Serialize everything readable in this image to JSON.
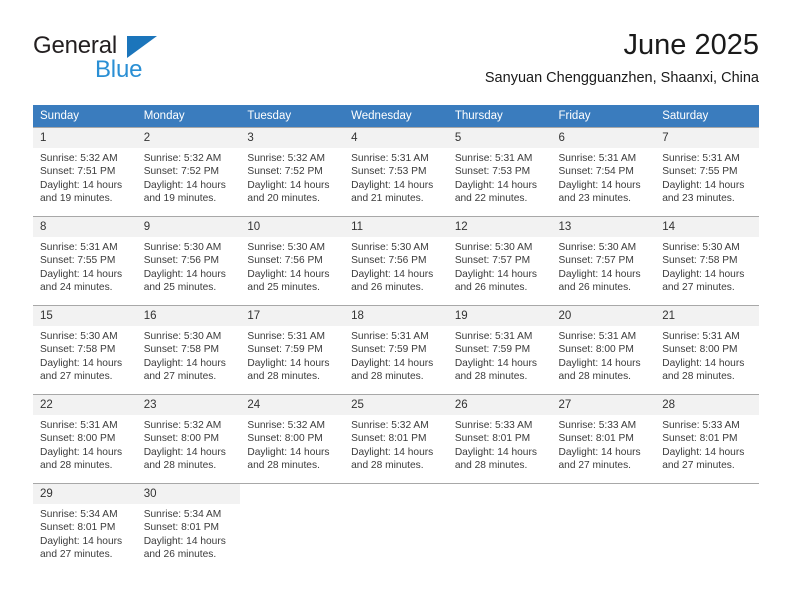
{
  "brand": {
    "name_top": "General",
    "name_bottom": "Blue",
    "accent_color": "#1b75bb",
    "accent_color_light": "#2a8fd4"
  },
  "header": {
    "title": "June 2025",
    "subtitle": "Sanyuan Chengguanzhen, Shaanxi, China"
  },
  "calendar": {
    "header_bg": "#3a7cbe",
    "daynum_bg": "#f2f2f2",
    "weekday_headers": [
      "Sunday",
      "Monday",
      "Tuesday",
      "Wednesday",
      "Thursday",
      "Friday",
      "Saturday"
    ],
    "weeks": [
      [
        {
          "day": "1",
          "sunrise": "Sunrise: 5:32 AM",
          "sunset": "Sunset: 7:51 PM",
          "daylight_1": "Daylight: 14 hours",
          "daylight_2": "and 19 minutes."
        },
        {
          "day": "2",
          "sunrise": "Sunrise: 5:32 AM",
          "sunset": "Sunset: 7:52 PM",
          "daylight_1": "Daylight: 14 hours",
          "daylight_2": "and 19 minutes."
        },
        {
          "day": "3",
          "sunrise": "Sunrise: 5:32 AM",
          "sunset": "Sunset: 7:52 PM",
          "daylight_1": "Daylight: 14 hours",
          "daylight_2": "and 20 minutes."
        },
        {
          "day": "4",
          "sunrise": "Sunrise: 5:31 AM",
          "sunset": "Sunset: 7:53 PM",
          "daylight_1": "Daylight: 14 hours",
          "daylight_2": "and 21 minutes."
        },
        {
          "day": "5",
          "sunrise": "Sunrise: 5:31 AM",
          "sunset": "Sunset: 7:53 PM",
          "daylight_1": "Daylight: 14 hours",
          "daylight_2": "and 22 minutes."
        },
        {
          "day": "6",
          "sunrise": "Sunrise: 5:31 AM",
          "sunset": "Sunset: 7:54 PM",
          "daylight_1": "Daylight: 14 hours",
          "daylight_2": "and 23 minutes."
        },
        {
          "day": "7",
          "sunrise": "Sunrise: 5:31 AM",
          "sunset": "Sunset: 7:55 PM",
          "daylight_1": "Daylight: 14 hours",
          "daylight_2": "and 23 minutes."
        }
      ],
      [
        {
          "day": "8",
          "sunrise": "Sunrise: 5:31 AM",
          "sunset": "Sunset: 7:55 PM",
          "daylight_1": "Daylight: 14 hours",
          "daylight_2": "and 24 minutes."
        },
        {
          "day": "9",
          "sunrise": "Sunrise: 5:30 AM",
          "sunset": "Sunset: 7:56 PM",
          "daylight_1": "Daylight: 14 hours",
          "daylight_2": "and 25 minutes."
        },
        {
          "day": "10",
          "sunrise": "Sunrise: 5:30 AM",
          "sunset": "Sunset: 7:56 PM",
          "daylight_1": "Daylight: 14 hours",
          "daylight_2": "and 25 minutes."
        },
        {
          "day": "11",
          "sunrise": "Sunrise: 5:30 AM",
          "sunset": "Sunset: 7:56 PM",
          "daylight_1": "Daylight: 14 hours",
          "daylight_2": "and 26 minutes."
        },
        {
          "day": "12",
          "sunrise": "Sunrise: 5:30 AM",
          "sunset": "Sunset: 7:57 PM",
          "daylight_1": "Daylight: 14 hours",
          "daylight_2": "and 26 minutes."
        },
        {
          "day": "13",
          "sunrise": "Sunrise: 5:30 AM",
          "sunset": "Sunset: 7:57 PM",
          "daylight_1": "Daylight: 14 hours",
          "daylight_2": "and 26 minutes."
        },
        {
          "day": "14",
          "sunrise": "Sunrise: 5:30 AM",
          "sunset": "Sunset: 7:58 PM",
          "daylight_1": "Daylight: 14 hours",
          "daylight_2": "and 27 minutes."
        }
      ],
      [
        {
          "day": "15",
          "sunrise": "Sunrise: 5:30 AM",
          "sunset": "Sunset: 7:58 PM",
          "daylight_1": "Daylight: 14 hours",
          "daylight_2": "and 27 minutes."
        },
        {
          "day": "16",
          "sunrise": "Sunrise: 5:30 AM",
          "sunset": "Sunset: 7:58 PM",
          "daylight_1": "Daylight: 14 hours",
          "daylight_2": "and 27 minutes."
        },
        {
          "day": "17",
          "sunrise": "Sunrise: 5:31 AM",
          "sunset": "Sunset: 7:59 PM",
          "daylight_1": "Daylight: 14 hours",
          "daylight_2": "and 28 minutes."
        },
        {
          "day": "18",
          "sunrise": "Sunrise: 5:31 AM",
          "sunset": "Sunset: 7:59 PM",
          "daylight_1": "Daylight: 14 hours",
          "daylight_2": "and 28 minutes."
        },
        {
          "day": "19",
          "sunrise": "Sunrise: 5:31 AM",
          "sunset": "Sunset: 7:59 PM",
          "daylight_1": "Daylight: 14 hours",
          "daylight_2": "and 28 minutes."
        },
        {
          "day": "20",
          "sunrise": "Sunrise: 5:31 AM",
          "sunset": "Sunset: 8:00 PM",
          "daylight_1": "Daylight: 14 hours",
          "daylight_2": "and 28 minutes."
        },
        {
          "day": "21",
          "sunrise": "Sunrise: 5:31 AM",
          "sunset": "Sunset: 8:00 PM",
          "daylight_1": "Daylight: 14 hours",
          "daylight_2": "and 28 minutes."
        }
      ],
      [
        {
          "day": "22",
          "sunrise": "Sunrise: 5:31 AM",
          "sunset": "Sunset: 8:00 PM",
          "daylight_1": "Daylight: 14 hours",
          "daylight_2": "and 28 minutes."
        },
        {
          "day": "23",
          "sunrise": "Sunrise: 5:32 AM",
          "sunset": "Sunset: 8:00 PM",
          "daylight_1": "Daylight: 14 hours",
          "daylight_2": "and 28 minutes."
        },
        {
          "day": "24",
          "sunrise": "Sunrise: 5:32 AM",
          "sunset": "Sunset: 8:00 PM",
          "daylight_1": "Daylight: 14 hours",
          "daylight_2": "and 28 minutes."
        },
        {
          "day": "25",
          "sunrise": "Sunrise: 5:32 AM",
          "sunset": "Sunset: 8:01 PM",
          "daylight_1": "Daylight: 14 hours",
          "daylight_2": "and 28 minutes."
        },
        {
          "day": "26",
          "sunrise": "Sunrise: 5:33 AM",
          "sunset": "Sunset: 8:01 PM",
          "daylight_1": "Daylight: 14 hours",
          "daylight_2": "and 28 minutes."
        },
        {
          "day": "27",
          "sunrise": "Sunrise: 5:33 AM",
          "sunset": "Sunset: 8:01 PM",
          "daylight_1": "Daylight: 14 hours",
          "daylight_2": "and 27 minutes."
        },
        {
          "day": "28",
          "sunrise": "Sunrise: 5:33 AM",
          "sunset": "Sunset: 8:01 PM",
          "daylight_1": "Daylight: 14 hours",
          "daylight_2": "and 27 minutes."
        }
      ],
      [
        {
          "day": "29",
          "sunrise": "Sunrise: 5:34 AM",
          "sunset": "Sunset: 8:01 PM",
          "daylight_1": "Daylight: 14 hours",
          "daylight_2": "and 27 minutes."
        },
        {
          "day": "30",
          "sunrise": "Sunrise: 5:34 AM",
          "sunset": "Sunset: 8:01 PM",
          "daylight_1": "Daylight: 14 hours",
          "daylight_2": "and 26 minutes."
        },
        {
          "day": "",
          "sunrise": "",
          "sunset": "",
          "daylight_1": "",
          "daylight_2": ""
        },
        {
          "day": "",
          "sunrise": "",
          "sunset": "",
          "daylight_1": "",
          "daylight_2": ""
        },
        {
          "day": "",
          "sunrise": "",
          "sunset": "",
          "daylight_1": "",
          "daylight_2": ""
        },
        {
          "day": "",
          "sunrise": "",
          "sunset": "",
          "daylight_1": "",
          "daylight_2": ""
        },
        {
          "day": "",
          "sunrise": "",
          "sunset": "",
          "daylight_1": "",
          "daylight_2": ""
        }
      ]
    ]
  }
}
